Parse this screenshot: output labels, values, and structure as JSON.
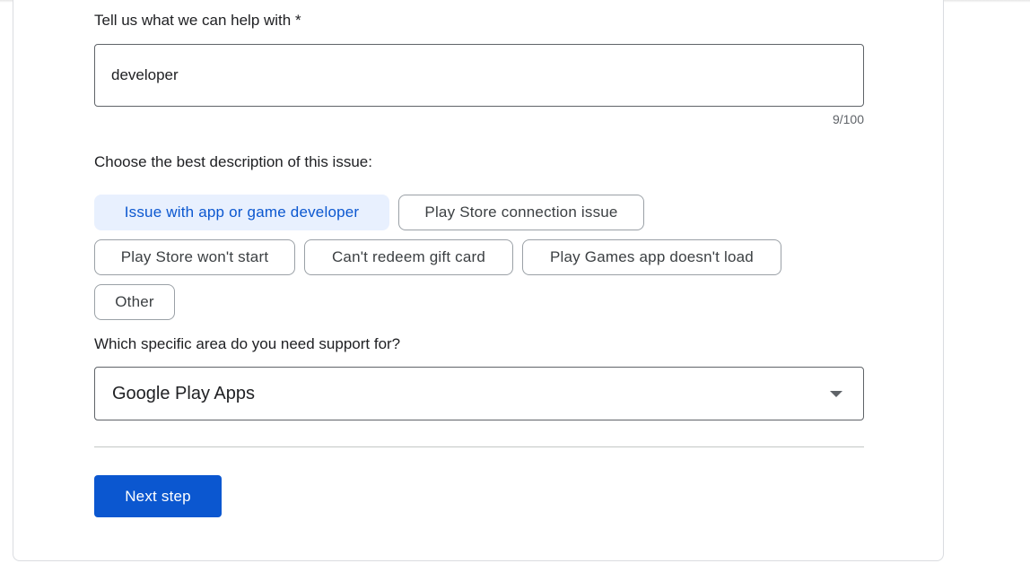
{
  "form": {
    "help_label": "Tell us what we can help with *",
    "help_value": "developer",
    "help_counter": "9/100",
    "issue_label": "Choose the best description of this issue:",
    "issue_options": [
      "Issue with app or game developer",
      "Play Store connection issue",
      "Play Store won't start",
      "Can't redeem gift card",
      "Play Games app doesn't load",
      "Other"
    ],
    "issue_selected": "Issue with app or game developer",
    "area_label": "Which specific area do you need support for?",
    "area_value": "Google Play Apps",
    "next_button": "Next step"
  },
  "colors": {
    "accent": "#0b57d0",
    "selected_chip_bg": "#e8f0fe",
    "border": "#5f6368"
  },
  "icons": {
    "dropdown": "triangle-down-icon"
  }
}
